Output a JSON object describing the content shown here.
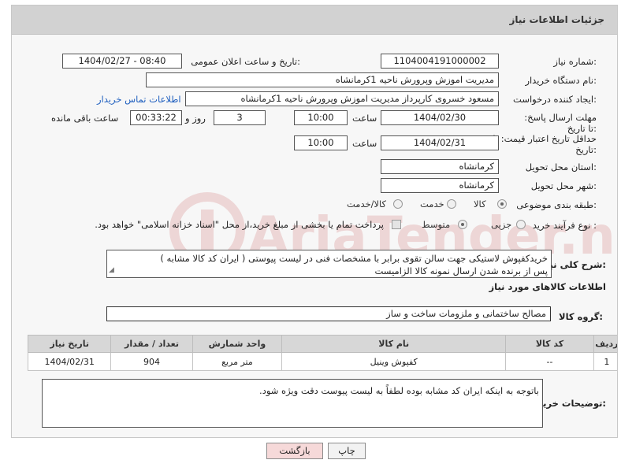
{
  "panel": {
    "title": "جزئیات اطلاعات نیاز"
  },
  "form": {
    "need_number": {
      "label": "شماره نیاز:",
      "value": "1104004191000002"
    },
    "announce": {
      "label": "تاریخ و ساعت اعلان عمومی:",
      "value": "1404/02/27 - 08:40"
    },
    "buyer_org": {
      "label": "نام دستگاه خریدار:",
      "value": "مدیریت اموزش وپرورش ناحیه 1کرمانشاه"
    },
    "creator": {
      "label": "ایجاد کننده درخواست:",
      "value": "مسعود خسروی کارپرداز مدیریت اموزش وپرورش ناحیه 1کرمانشاه",
      "contact_link": "اطلاعات تماس خریدار"
    },
    "reply_deadline": {
      "label": "مهلت ارسال پاسخ: تا تاریخ:",
      "date": "1404/02/30",
      "time_label": "ساعت",
      "time": "10:00",
      "days": "3",
      "days_label": "روز و",
      "remaining": "00:33:22",
      "remaining_label": "ساعت باقی مانده"
    },
    "price_deadline": {
      "label": "حداقل تاریخ اعتبار قیمت: تا تاریخ:",
      "date": "1404/02/31",
      "time_label": "ساعت",
      "time": "10:00"
    },
    "province": {
      "label": "استان محل تحویل:",
      "value": "کرمانشاه"
    },
    "city": {
      "label": "شهر محل تحویل:",
      "value": "کرمانشاه"
    },
    "category": {
      "label": "طبقه بندی موضوعی:",
      "options": [
        "کالا",
        "خدمت",
        "کالا/خدمت"
      ],
      "selected": "کالا"
    },
    "process": {
      "label": "نوع فرآیند خرید :",
      "options": [
        "جزیی",
        "متوسط"
      ],
      "selected": "متوسط",
      "payment_note": "پرداخت تمام یا بخشی از مبلغ خرید،از محل \"اسناد خزانه اسلامی\" خواهد بود."
    }
  },
  "need_description": {
    "label": "شرح کلی نیاز:",
    "line1": "خریدکفپوش لاستیکی جهت سالن تقوی برابر با مشخصات فنی در لیست پیوستی ( ایران کد کالا مشابه  )",
    "line2": "پس از برنده شدن ارسال نمونه کالا الزامیست"
  },
  "goods_section": {
    "title": "اطلاعات کالاهای مورد نیاز"
  },
  "goods_group": {
    "label": "گروه کالا:",
    "value": "مصالح ساختمانی و ملزومات ساخت و ساز"
  },
  "table": {
    "headers": [
      "ردیف",
      "کد کالا",
      "نام کالا",
      "واحد شمارش",
      "تعداد / مقدار",
      "تاریخ نیاز"
    ],
    "rows": [
      [
        "1",
        "--",
        "کفپوش وینیل",
        "متر مربع",
        "904",
        "1404/02/31"
      ]
    ]
  },
  "buyer_notes": {
    "label": "توضیحات خریدار:",
    "value": "باتوجه به اینکه ایران  کد مشابه بوده لطفاً به لیست پیوست دقت ویژه شود."
  },
  "buttons": {
    "print": "چاپ",
    "back": "بازگشت"
  },
  "watermark": {
    "text": "AriaTender.net"
  },
  "colors": {
    "header_bg": "#d2d2d2",
    "link": "#1f5fbf",
    "back_button": "#f6d9d9"
  }
}
